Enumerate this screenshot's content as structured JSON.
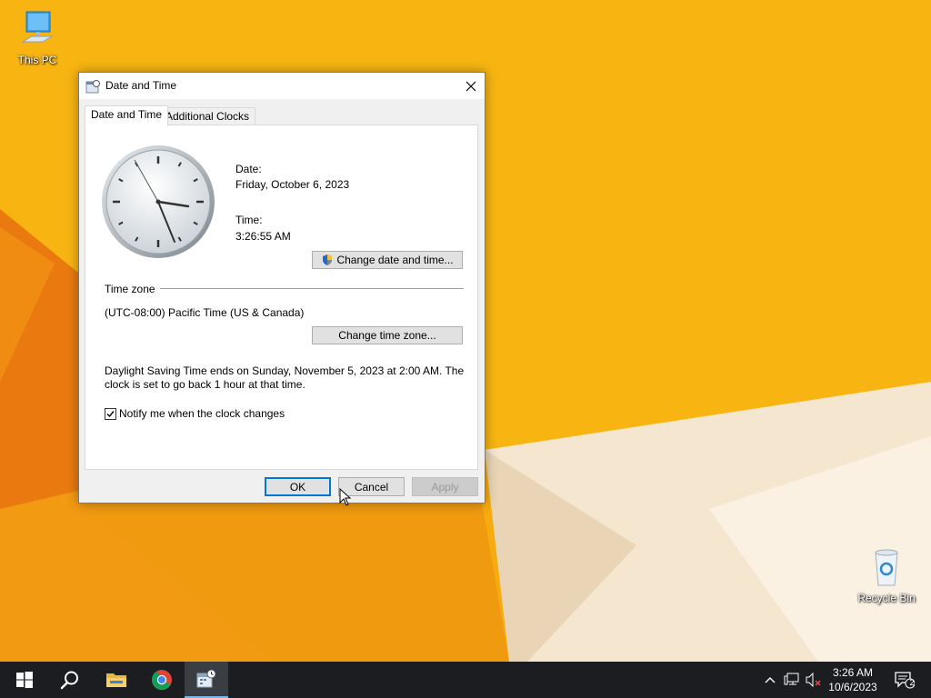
{
  "desktop": {
    "icons": [
      {
        "label": "This PC",
        "icon": "computer-icon"
      },
      {
        "label": "Recycle Bin",
        "icon": "recycle-bin-icon"
      }
    ]
  },
  "dialog": {
    "title": "Date and Time",
    "tabs": [
      {
        "label": "Date and Time",
        "active": true
      },
      {
        "label": "Additional Clocks",
        "active": false
      }
    ],
    "date_label": "Date:",
    "date_value": "Friday, October 6, 2023",
    "time_label": "Time:",
    "time_value": "3:26:55 AM",
    "change_datetime_button": "Change date and time...",
    "timezone_heading": "Time zone",
    "timezone_value": "(UTC-08:00) Pacific Time (US & Canada)",
    "change_timezone_button": "Change time zone...",
    "dst_info_line1": "Daylight Saving Time ends on Sunday, November 5, 2023 at 2:00 AM. The",
    "dst_info_line2": "clock is set to go back 1 hour at that time.",
    "notify_checkbox": {
      "label": "Notify me when the clock changes",
      "checked": true
    },
    "buttons": {
      "ok": "OK",
      "cancel": "Cancel",
      "apply": "Apply"
    }
  },
  "taskbar": {
    "items": [
      {
        "name": "start",
        "icon": "windows-icon"
      },
      {
        "name": "search",
        "icon": "search-icon"
      },
      {
        "name": "file-explorer",
        "icon": "folder-icon"
      },
      {
        "name": "chrome",
        "icon": "chrome-icon"
      },
      {
        "name": "date-and-time",
        "icon": "date-time-icon",
        "active": true
      }
    ],
    "tray": {
      "time": "3:26 AM",
      "date": "10/6/2023",
      "notification_count": "2"
    }
  },
  "colors": {
    "accent": "#0078d7",
    "taskbar": "#1b1d21",
    "wallpaper": "#f4a80d"
  }
}
